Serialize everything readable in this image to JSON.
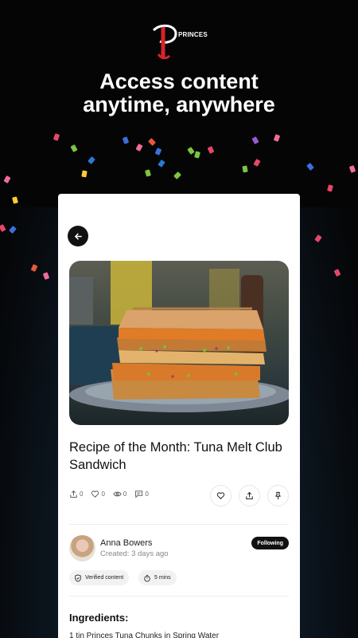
{
  "brand": {
    "logo_text": "PRINCES",
    "logo_color": "#d8232a"
  },
  "headline": {
    "line1": "Access content",
    "line2": "anytime, anywhere"
  },
  "recipe": {
    "title": "Recipe of the Month: Tuna Melt Club Sandwich",
    "stats": {
      "shares": "0",
      "likes": "0",
      "views": "0",
      "comments": "0"
    }
  },
  "author": {
    "name": "Anna Bowers",
    "created": "Created: 3 days ago",
    "follow_label": "Following"
  },
  "chips": {
    "verified": "Verified content",
    "duration": "5 mins"
  },
  "ingredients": {
    "heading": "Ingredients:",
    "first_item": "1 tin Princes Tuna Chunks in Spring Water"
  },
  "icons": {
    "back": "arrow-left-icon",
    "share_stat": "share-icon",
    "like_stat": "heart-icon",
    "views": "eye-icon",
    "comments": "comment-icon",
    "like_action": "heart-icon",
    "share_action": "share-icon",
    "pin_action": "pin-icon",
    "verified": "shield-check-icon",
    "duration": "timer-icon"
  },
  "colors": {
    "background": "#050505",
    "card": "#ffffff",
    "accent_dark": "#111111"
  }
}
